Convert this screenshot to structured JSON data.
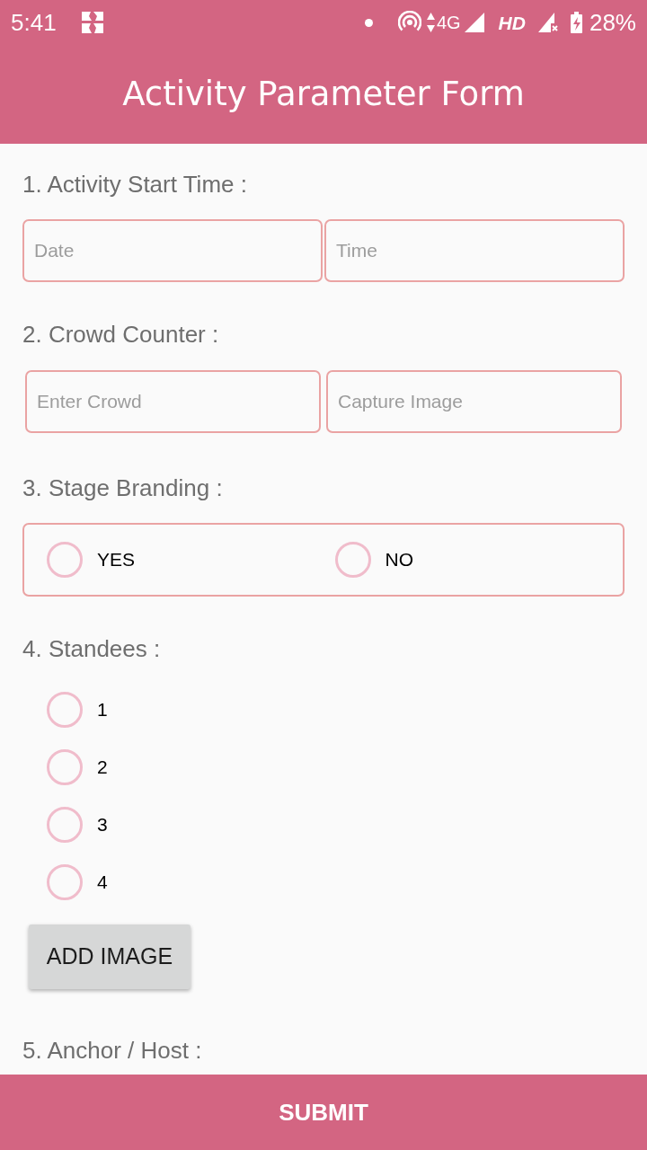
{
  "status_bar": {
    "time": "5:41",
    "network": "4G",
    "hd": "HD",
    "battery": "28%"
  },
  "app_bar": {
    "title": "Activity Parameter Form"
  },
  "sections": [
    {
      "kind": "fields",
      "label": "1. Activity Start Time :",
      "fields": [
        {
          "placeholder": "Date"
        },
        {
          "placeholder": "Time"
        }
      ]
    },
    {
      "kind": "fields",
      "label": "2. Crowd Counter :",
      "fields": [
        {
          "placeholder": "Enter Crowd"
        },
        {
          "placeholder": "Capture Image"
        }
      ]
    },
    {
      "kind": "radio_row",
      "label": "3. Stage Branding :",
      "options": [
        {
          "label": "YES",
          "selected": false
        },
        {
          "label": "NO",
          "selected": false
        }
      ]
    },
    {
      "kind": "radio_column",
      "label": "4. Standees :",
      "options": [
        {
          "label": "1",
          "selected": false
        },
        {
          "label": "2",
          "selected": false
        },
        {
          "label": "3",
          "selected": false
        },
        {
          "label": "4",
          "selected": false
        }
      ],
      "button": "ADD IMAGE"
    },
    {
      "kind": "heading",
      "label": "5. Anchor / Host :"
    }
  ],
  "submit": "SUBMIT"
}
